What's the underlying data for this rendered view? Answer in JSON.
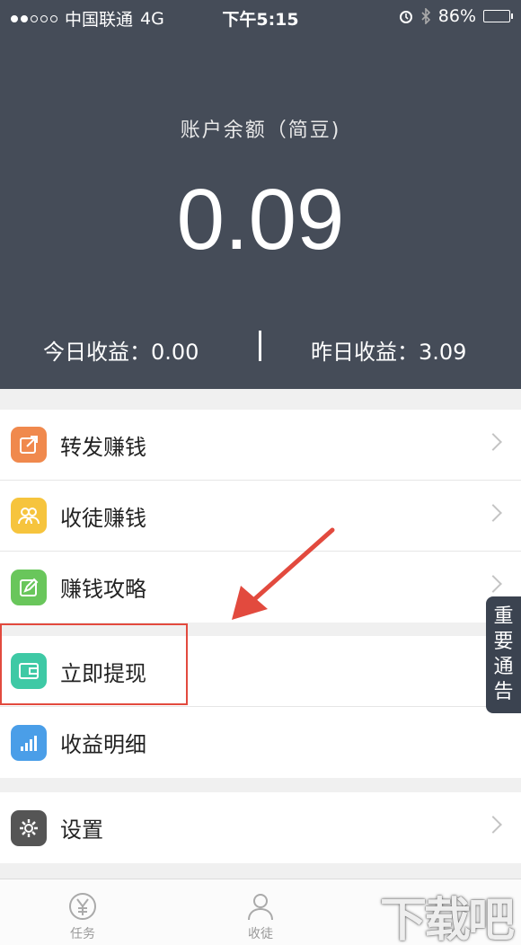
{
  "status_bar": {
    "carrier": "中国联通",
    "network": "4G",
    "time": "下午5:15",
    "battery": "86%",
    "battery_level": 0.86
  },
  "header": {
    "balance_label": "账户余额（简豆)",
    "balance_value": "0.09",
    "today_label": "今日收益：0.00",
    "yesterday_label": "昨日收益：3.09",
    "background_color": "#454c58"
  },
  "menu": {
    "group1": [
      {
        "label": "转发赚钱",
        "icon": "share-icon",
        "color": "#f0894d"
      },
      {
        "label": "收徒赚钱",
        "icon": "people-icon",
        "color": "#f6c43d"
      },
      {
        "label": "赚钱攻略",
        "icon": "edit-icon",
        "color": "#69c65b"
      }
    ],
    "group2": [
      {
        "label": "立即提现",
        "icon": "wallet-icon",
        "color": "#3ec9a5"
      },
      {
        "label": "收益明细",
        "icon": "chart-icon",
        "color": "#4a9ee8"
      }
    ],
    "group3": [
      {
        "label": "设置",
        "icon": "gear-icon",
        "color": "#555555"
      }
    ]
  },
  "notice_tab": {
    "chars": [
      "重",
      "要",
      "通",
      "告"
    ]
  },
  "tabbar": {
    "items": [
      {
        "label": "任务",
        "icon": "yuan-icon"
      },
      {
        "label": "收徒",
        "icon": "user-icon"
      }
    ]
  },
  "watermark": "下载吧",
  "annotation_color": "#e24a3e"
}
